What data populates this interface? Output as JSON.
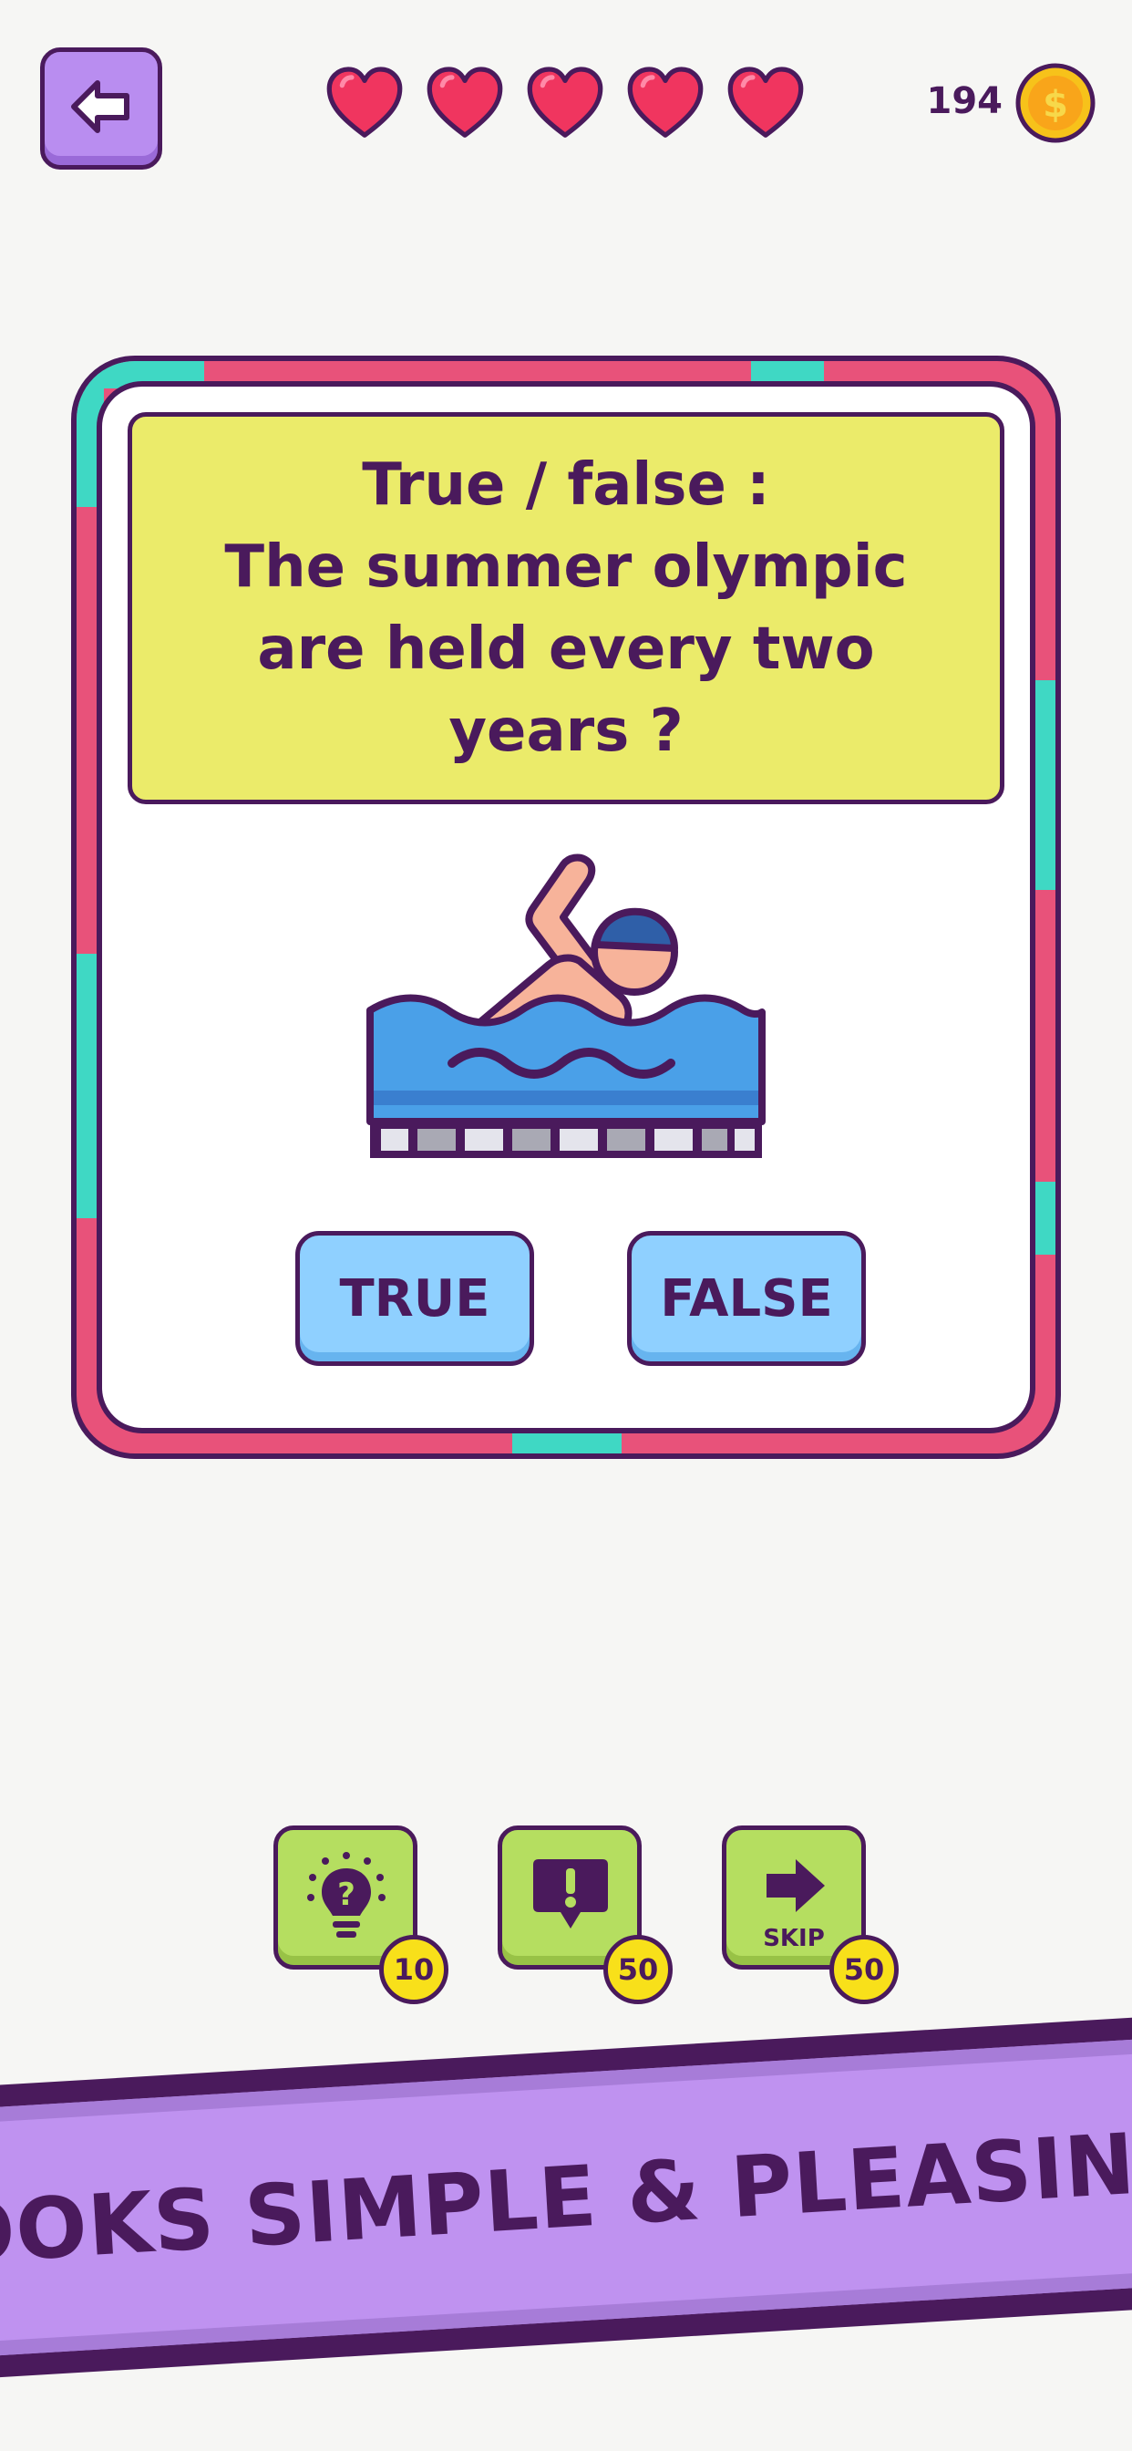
{
  "top_bar": {
    "back_icon": "arrow-left-icon",
    "lives": 5,
    "coins": "194",
    "coin_icon": "dollar-coin-icon"
  },
  "question": {
    "text": "True / false :\nThe summer olympic\nare held every two\nyears ?",
    "illustration": "swimmer-icon"
  },
  "answers": {
    "true_label": "TRUE",
    "false_label": "FALSE"
  },
  "powerups": [
    {
      "icon": "lightbulb-question-icon",
      "cost": "10"
    },
    {
      "icon": "exclamation-speech-bubble-icon",
      "cost": "50"
    },
    {
      "icon": "arrow-right-icon",
      "label": "SKIP",
      "cost": "50"
    }
  ],
  "banner": {
    "text": "LOOKS SIMPLE & PLEASING."
  },
  "colors": {
    "background": "#f6f6f4",
    "outline": "#4a1a5c",
    "frame_pink": "#e8527a",
    "frame_teal": "#3fd8c4",
    "question_yellow": "#ebeb6a",
    "answer_blue": "#8fd0ff",
    "powerup_green": "#b5de60",
    "badge_yellow": "#f8e01a",
    "banner_purple": "#bf92f0",
    "heart_red": "#f0355f",
    "coin_gold": "#f7c21a"
  }
}
